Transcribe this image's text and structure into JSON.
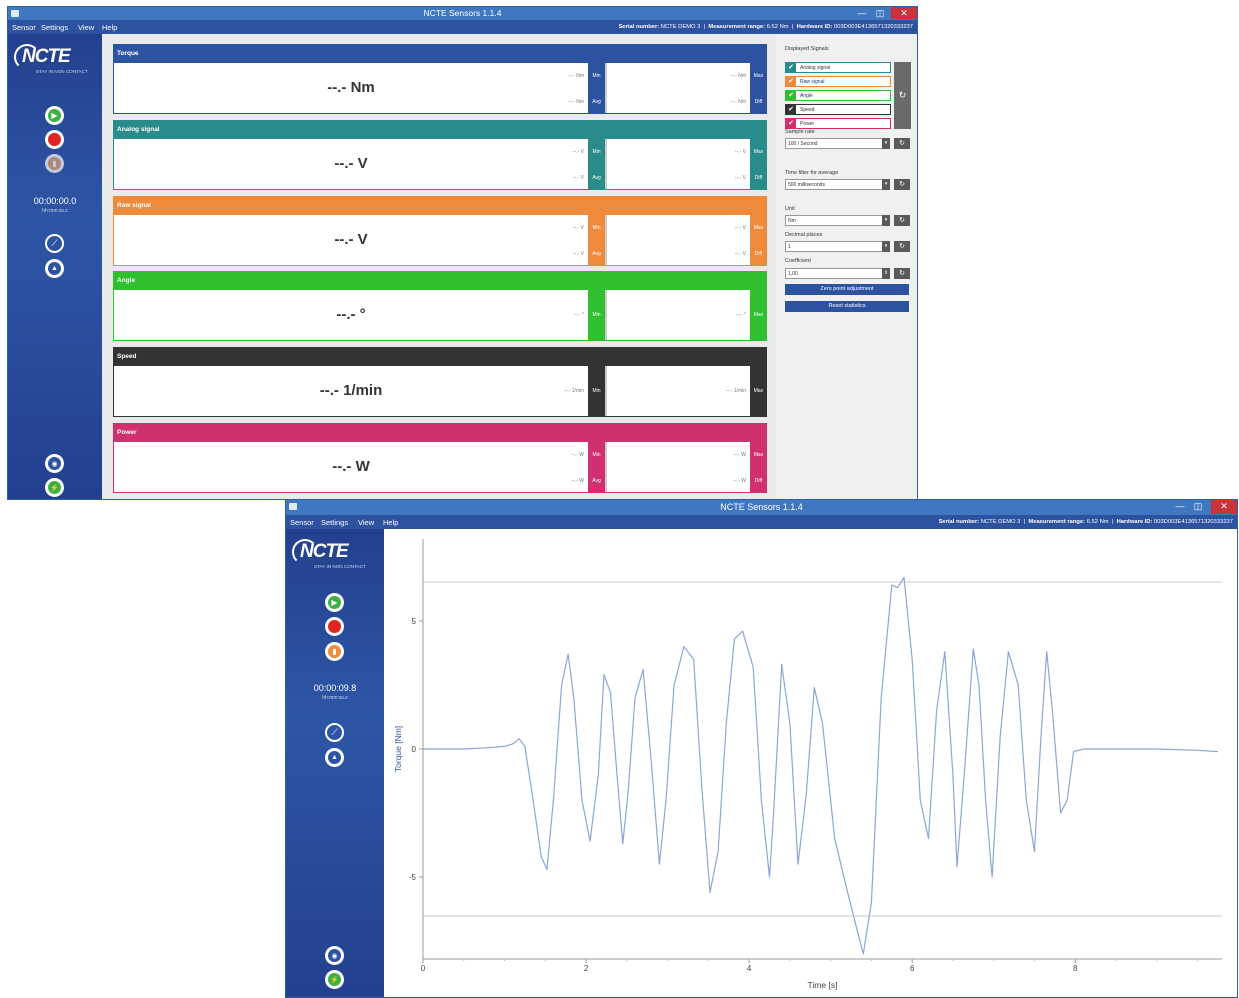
{
  "app": {
    "title": "NCTE Sensors 1.1.4",
    "minimize_glyph": "—",
    "maximize_glyph": "◫",
    "close_glyph": "✕"
  },
  "menu": [
    "Sensor",
    "Settings",
    "View",
    "Help"
  ],
  "header": {
    "serial_label": "Serial number:",
    "serial_value": "NCTE DEMO 3",
    "range_label": "Measurement range:",
    "range_value": "6.52 Nm",
    "hw_label": "Hardware ID:",
    "hw_value": "003D003E4136571320333237",
    "separator": "|"
  },
  "logo": {
    "name": "NCTE",
    "tagline": "STAY IN NON CONTACT"
  },
  "window1": {
    "timer": "00:00:00.0",
    "timer_format": "hh:mm:ss.z",
    "panels": [
      {
        "name": "Torque",
        "value": "--.- Nm",
        "small": [
          "--.- Nm",
          "--.- Nm",
          "--.- Nm",
          "--.- Nm"
        ],
        "tags": [
          "Min",
          "Avg",
          "Max",
          "Diff"
        ],
        "color": "#2d52a0"
      },
      {
        "name": "Analog signal",
        "value": "--.- V",
        "small": [
          "--.- V",
          "--.- V",
          "--.- V",
          "--.- V"
        ],
        "tags": [
          "Min",
          "Avg",
          "Max",
          "Diff"
        ],
        "color": "#2a8b8b"
      },
      {
        "name": "Raw signal",
        "value": "--.- V",
        "small": [
          "--.- V",
          "--.- V",
          "--.- V",
          "--.- V"
        ],
        "tags": [
          "Min",
          "Avg",
          "Max",
          "Diff"
        ],
        "color": "#ee8a3a"
      },
      {
        "name": "Angle",
        "value": "--.- °",
        "small": [
          "--.- °",
          "--.- °"
        ],
        "tags": [
          "Min",
          "Max"
        ],
        "color": "#2fbf2f"
      },
      {
        "name": "Speed",
        "value": "--.- 1/min",
        "small": [
          "--.- 1/min",
          "--.- 1/min"
        ],
        "tags": [
          "Min",
          "Max"
        ],
        "color": "#333333"
      },
      {
        "name": "Power",
        "value": "--.- W",
        "small": [
          "--.- W",
          "--.- W",
          "--.- W",
          "--.- W"
        ],
        "tags": [
          "Min",
          "Avg",
          "Max",
          "Diff"
        ],
        "color": "#d0306f"
      }
    ],
    "settings": {
      "displayed_signals_label": "Displayed Signals",
      "signals": [
        {
          "name": "Analog signal",
          "color": "#2a8b8b"
        },
        {
          "name": "Raw signal",
          "color": "#ee8a3a"
        },
        {
          "name": "Angle",
          "color": "#2fbf2f"
        },
        {
          "name": "Speed",
          "color": "#333333"
        },
        {
          "name": "Power",
          "color": "#d0306f"
        }
      ],
      "sample_rate_label": "Sample rate",
      "sample_rate_value": "100 / Second",
      "time_filter_label": "Time filter for average",
      "time_filter_value": "500 milliseconds",
      "unit_label": "Unit",
      "unit_value": "Nm",
      "decimal_label": "Decimal places",
      "decimal_value": "1",
      "coefficient_label": "Coefficient",
      "coefficient_value": "1,00",
      "zero_button": "Zero point adjustment",
      "reset_button": "Reset statistics"
    }
  },
  "window2": {
    "timer": "00:00:09.8",
    "timer_format": "hh:mm:ss.z"
  },
  "chart_data": {
    "type": "line",
    "title": "",
    "xlabel": "Time [s]",
    "ylabel": "Torque [Nm]",
    "xlim": [
      0,
      9.8
    ],
    "ylim": [
      -8.2,
      8.2
    ],
    "x_ticks": [
      0,
      2,
      4,
      6,
      8
    ],
    "y_ticks": [
      -5,
      0,
      5
    ],
    "limit_lines": [
      6.52,
      -6.52
    ],
    "series": [
      {
        "color": "#8aa6d8",
        "x": [
          0,
          0.5,
          0.8,
          1.0,
          1.1,
          1.18,
          1.25,
          1.35,
          1.45,
          1.52,
          1.6,
          1.7,
          1.78,
          1.85,
          1.95,
          2.05,
          2.15,
          2.22,
          2.3,
          2.38,
          2.45,
          2.52,
          2.6,
          2.7,
          2.8,
          2.9,
          2.98,
          3.08,
          3.2,
          3.32,
          3.42,
          3.52,
          3.62,
          3.72,
          3.82,
          3.92,
          4.05,
          4.15,
          4.25,
          4.3,
          4.4,
          4.5,
          4.6,
          4.7,
          4.8,
          4.9,
          5.05,
          5.2,
          5.32,
          5.4,
          5.5,
          5.62,
          5.75,
          5.82,
          5.9,
          6.0,
          6.1,
          6.2,
          6.3,
          6.4,
          6.5,
          6.55,
          6.65,
          6.75,
          6.82,
          6.9,
          6.98,
          7.08,
          7.18,
          7.3,
          7.4,
          7.5,
          7.58,
          7.65,
          7.72,
          7.82,
          7.9,
          7.98,
          8.1,
          8.2,
          8.5,
          9.0,
          9.5,
          9.75
        ],
        "y": [
          0,
          0,
          0.05,
          0.1,
          0.2,
          0.4,
          0.1,
          -2.0,
          -4.2,
          -4.7,
          -2.0,
          2.5,
          3.7,
          2.0,
          -2.0,
          -3.6,
          -1.0,
          2.9,
          2.2,
          -1.0,
          -3.7,
          -1.5,
          2.0,
          3.1,
          -0.5,
          -4.5,
          -2.0,
          2.5,
          4.0,
          3.5,
          -1.5,
          -5.6,
          -4.0,
          1.0,
          4.3,
          4.6,
          3.2,
          -2.0,
          -5.0,
          -2.5,
          3.3,
          1.0,
          -4.5,
          -1.8,
          2.4,
          1.0,
          -3.5,
          -5.5,
          -7.0,
          -8.0,
          -6.0,
          2.0,
          6.4,
          6.3,
          6.7,
          3.5,
          -2.0,
          -3.5,
          1.5,
          3.8,
          -1.0,
          -4.6,
          -0.5,
          3.9,
          2.5,
          -2.0,
          -5.0,
          0.5,
          3.8,
          2.5,
          -2.0,
          -4.0,
          0.5,
          3.8,
          1.5,
          -2.5,
          -2.0,
          -0.1,
          0,
          0,
          0,
          0,
          -0.05,
          -0.1
        ]
      }
    ]
  }
}
